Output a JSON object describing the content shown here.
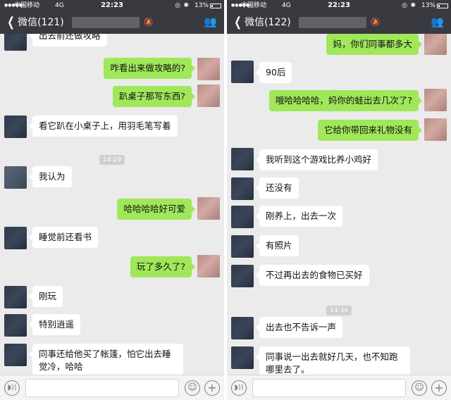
{
  "left": {
    "status": {
      "carrier": "中国移动",
      "network": "4G",
      "time": "22:23",
      "battery": "13%"
    },
    "nav": {
      "back_label": "微信(121)"
    },
    "messages": [
      {
        "text": "出去前还做攻略"
      },
      {
        "text": "咋看出来做攻略的?"
      },
      {
        "text": "趴桌子那写东西?"
      },
      {
        "text": "看它趴在小桌子上，用羽毛笔写着"
      },
      {
        "time": "14:29"
      },
      {
        "text": "我认为"
      },
      {
        "text": "哈哈哈哈好可爱"
      },
      {
        "text": "睡觉前还看书"
      },
      {
        "text": "玩了多久了?"
      },
      {
        "text": "刚玩"
      },
      {
        "text": "特别逍遥"
      },
      {
        "text": "同事还给他买了帐篷，怕它出去睡觉冷，哈哈"
      }
    ]
  },
  "right": {
    "status": {
      "carrier": "中国移动",
      "network": "4G",
      "time": "22:23",
      "battery": "13%"
    },
    "nav": {
      "back_label": "微信(122)"
    },
    "messages": [
      {
        "text": "妈，你们同事都多大"
      },
      {
        "text": "90后"
      },
      {
        "text": "哦哈哈哈哈，妈你的蛙出去几次了?"
      },
      {
        "text": "它给你带回来礼物没有"
      },
      {
        "text": "我听到这个游戏比养小鸡好"
      },
      {
        "text": "还没有"
      },
      {
        "text": "刚养上，出去一次"
      },
      {
        "text": "有照片"
      },
      {
        "text": "不过再出去的食物已买好"
      },
      {
        "time": "14:34"
      },
      {
        "text": "出去也不告诉一声"
      },
      {
        "text": "同事说一出去就好几天，也不知跑哪里去了。"
      }
    ]
  },
  "icons": {
    "back": "chevron-left-icon",
    "mute": "bell-off-icon",
    "contacts": "people-icon",
    "voice": "voice-icon",
    "emoji": "emoji-icon",
    "more": "plus-icon"
  },
  "colors": {
    "nav_bg": "#393a3f",
    "chat_bg": "#ebebeb",
    "my_bubble": "#a0e75a",
    "their_bubble": "#ffffff"
  }
}
